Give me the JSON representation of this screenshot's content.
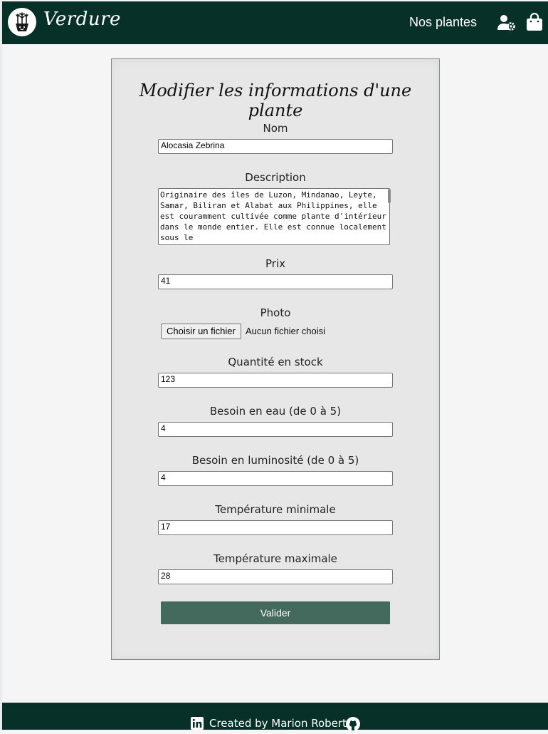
{
  "header": {
    "brand": "Verdure",
    "nav_link": "Nos plantes",
    "icons": [
      "plant-pot-logo-icon",
      "user-settings-icon",
      "shopping-bag-icon"
    ]
  },
  "form": {
    "title": "Modifier les informations d'une plante",
    "fields": {
      "name": {
        "label": "Nom",
        "value": "Alocasia Zebrina"
      },
      "description": {
        "label": "Description",
        "value": "Originaire des îles de Luzon, Mindanao, Leyte, Samar, Biliran et Alabat aux Philippines, elle est couramment cultivée comme plante d'intérieur dans le monde entier. Elle est connue localement sous le"
      },
      "price": {
        "label": "Prix",
        "value": "41"
      },
      "photo": {
        "label": "Photo",
        "button": "Choisir un fichier",
        "status": "Aucun fichier choisi"
      },
      "stock": {
        "label": "Quantité en stock",
        "value": "123"
      },
      "water": {
        "label": "Besoin en eau (de 0 à 5)",
        "value": "4"
      },
      "light": {
        "label": "Besoin en luminosité (de 0 à 5)",
        "value": "4"
      },
      "temp_min": {
        "label": "Température minimale",
        "value": "17"
      },
      "temp_max": {
        "label": "Température maximale",
        "value": "28"
      }
    },
    "submit_label": "Valider"
  },
  "footer": {
    "text": "Created by Marion Robert",
    "icons": [
      "linkedin-icon",
      "github-icon"
    ]
  },
  "colors": {
    "header_bg": "#073128",
    "button_bg": "#436a5d",
    "page_bg": "#f5f5f5",
    "card_bg": "#e7e7e7"
  }
}
